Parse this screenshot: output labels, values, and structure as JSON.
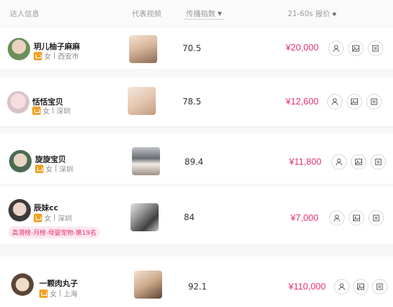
{
  "columns": {
    "influencer_info": "达人信息",
    "video": "代表视频",
    "spread_index": "传播指数",
    "price": "21-60s 报价"
  },
  "rows": [
    {
      "name": "玥儿柚子麻麻",
      "gender": "女",
      "sep": "|",
      "city": "西安市",
      "score": "70.5",
      "price": "¥20,000"
    },
    {
      "name": "恬恬宝贝",
      "gender": "女",
      "sep": "|",
      "city": "深圳",
      "score": "78.5",
      "price": "¥12,600"
    },
    {
      "name": "旋旋宝贝",
      "gender": "女",
      "sep": "|",
      "city": "深圳",
      "score": "89.4",
      "price": "¥11,800"
    },
    {
      "name": "辰妹cc",
      "gender": "女",
      "sep": "|",
      "city": "深圳",
      "score": "84",
      "price": "¥7,000",
      "tag": "高潜榜-月榜-母婴宠物-第19名"
    },
    {
      "name": "一颗肉丸子",
      "gender": "女",
      "sep": "|",
      "city": "上海",
      "score": "92.1",
      "price": "¥110,000"
    }
  ],
  "colors": {
    "price": "#e8316e",
    "crown": "#f0a329"
  },
  "icons": [
    "user-icon",
    "image-icon",
    "card-icon"
  ]
}
